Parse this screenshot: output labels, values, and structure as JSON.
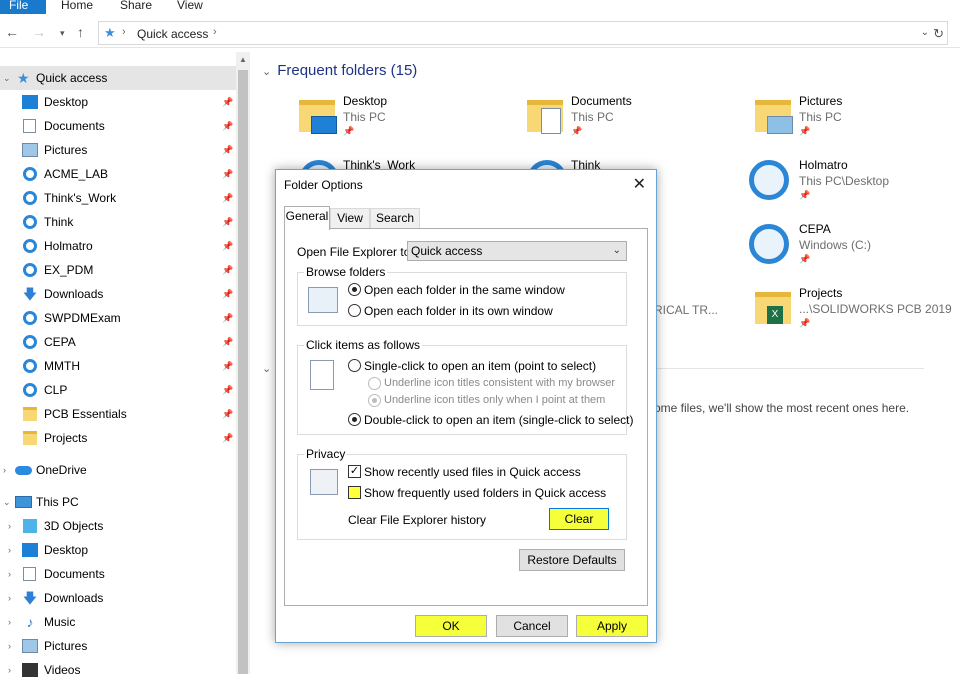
{
  "ribbon": {
    "file": "File",
    "tabs": [
      "Home",
      "Share",
      "View"
    ]
  },
  "address": {
    "crumb": "Quick access"
  },
  "nav": {
    "quick_access": "Quick access",
    "items": [
      "Desktop",
      "Documents",
      "Pictures",
      "ACME_LAB",
      "Think's_Work",
      "Think",
      "Holmatro",
      "EX_PDM",
      "Downloads",
      "SWPDMExam",
      "CEPA",
      "MMTH",
      "CLP",
      "PCB Essentials",
      "Projects"
    ],
    "onedrive": "OneDrive",
    "this_pc": "This PC",
    "pc_items": [
      "3D Objects",
      "Desktop",
      "Documents",
      "Downloads",
      "Music",
      "Pictures",
      "Videos"
    ]
  },
  "main": {
    "frequent_title": "Frequent folders (15)",
    "tiles": [
      {
        "name": "Desktop",
        "sub": "This PC"
      },
      {
        "name": "Documents",
        "sub": "This PC"
      },
      {
        "name": "Pictures",
        "sub": "This PC"
      },
      {
        "name": "Think's_Work",
        "sub": ""
      },
      {
        "name": "Think",
        "sub": ""
      },
      {
        "name": "Holmatro",
        "sub": "This PC\\Desktop"
      },
      {
        "name": "CEPA",
        "sub": "Windows (C:)"
      },
      {
        "name": "Projects",
        "sub": "...\\SOLIDWORKS PCB 2019"
      }
    ],
    "truncated": "RICAL TR...",
    "recent_msg": "ome files, we'll show the most recent ones here."
  },
  "dialog": {
    "title": "Folder Options",
    "tabs": [
      "General",
      "View",
      "Search"
    ],
    "open_label": "Open File Explorer to:",
    "open_value": "Quick access",
    "browse": {
      "title": "Browse folders",
      "opt1": "Open each folder in the same window",
      "opt2": "Open each folder in its own window"
    },
    "click": {
      "title": "Click items as follows",
      "single": "Single-click to open an item (point to select)",
      "sub1": "Underline icon titles consistent with my browser",
      "sub2": "Underline icon titles only when I point at them",
      "double": "Double-click to open an item (single-click to select)"
    },
    "privacy": {
      "title": "Privacy",
      "recent_files": "Show recently used files in Quick access",
      "frequent_folders": "Show frequently used folders in Quick access",
      "clear_label": "Clear File Explorer history",
      "clear_button": "Clear"
    },
    "restore": "Restore Defaults",
    "ok": "OK",
    "cancel": "Cancel",
    "apply": "Apply"
  }
}
